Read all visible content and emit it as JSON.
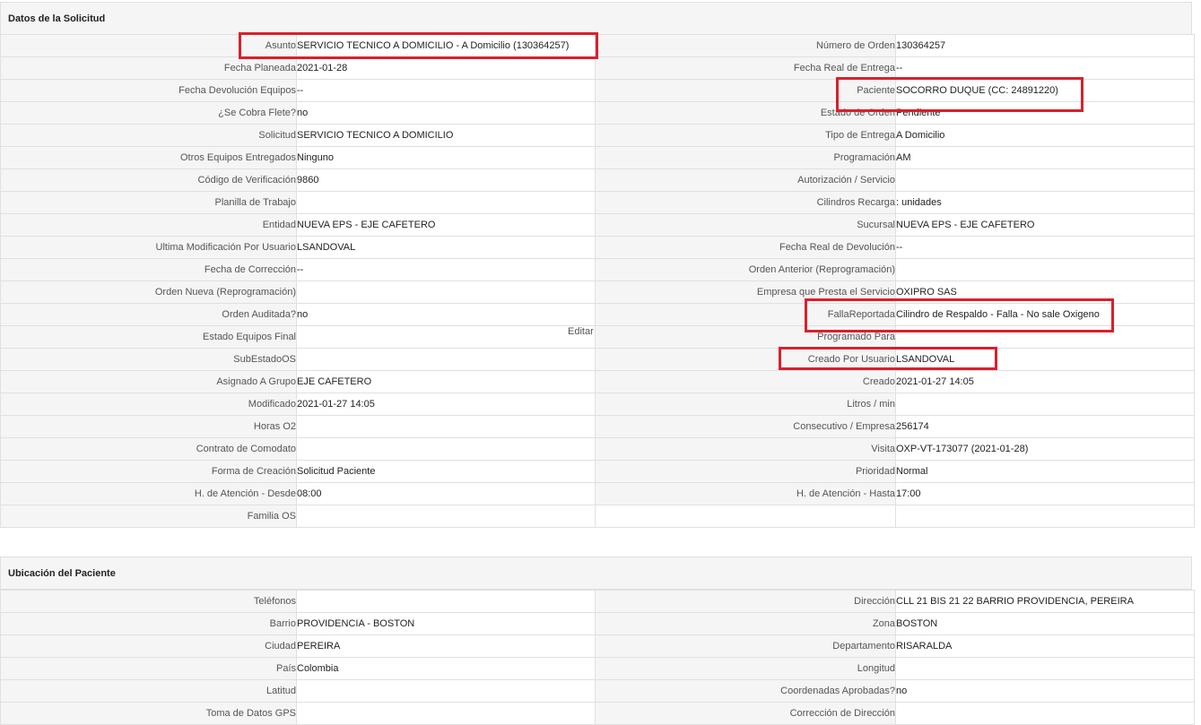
{
  "section1": {
    "title": "Datos de la Solicitud",
    "rows": [
      {
        "l1": "Asunto",
        "v1": "SERVICIO TECNICO A DOMICILIO - A Domicilio (130364257)",
        "l2": "Número de Orden",
        "v2": "130364257"
      },
      {
        "l1": "Fecha Planeada",
        "v1": " 2021-01-28",
        "l2": "Fecha Real de Entrega",
        "v2": "--"
      },
      {
        "l1": "Fecha Devolución Equipos",
        "v1": "--",
        "l2": "Paciente",
        "v2": "SOCORRO DUQUE (CC: 24891220)"
      },
      {
        "l1": "¿Se Cobra Flete?",
        "v1": " no",
        "l2": "Estado de Orden",
        "v2": "Pendiente"
      },
      {
        "l1": "Solicitud",
        "v1": "SERVICIO TECNICO A DOMICILIO",
        "l2": "Tipo de Entrega",
        "v2": "A Domicilio"
      },
      {
        "l1": "Otros Equipos Entregados",
        "v1": "Ninguno",
        "l2": "Programación",
        "v2": "AM"
      },
      {
        "l1": "Código de Verificación",
        "v1": "9860",
        "l2": "Autorización / Servicio",
        "v2": ""
      },
      {
        "l1": "Planilla de Trabajo",
        "v1": "",
        "l2": "Cilindros Recarga",
        "v2": ": unidades"
      },
      {
        "l1": "Entidad",
        "v1": "NUEVA EPS - EJE CAFETERO",
        "l2": "Sucursal",
        "v2": "NUEVA EPS - EJE CAFETERO"
      },
      {
        "l1": "Ultima Modificación Por Usuario",
        "v1": "LSANDOVAL",
        "l2": "Fecha Real de Devolución",
        "v2": "--"
      },
      {
        "l1": "Fecha de Corrección",
        "v1": "--",
        "l2": "Orden Anterior (Reprogramación)",
        "v2": ""
      },
      {
        "l1": "Orden Nueva (Reprogramación)",
        "v1": "",
        "l2": "Empresa que Presta el Servicio",
        "v2": "OXIPRO SAS"
      },
      {
        "l1": "Orden Auditada?",
        "v1": " no",
        "l2": "FallaReportada",
        "v2": "Cilindro de Respaldo - Falla - No sale Oxigeno"
      },
      {
        "l1": "Estado Equipos Final",
        "v1": "",
        "l2": "Programado Para",
        "v2": ""
      },
      {
        "l1": "SubEstadoOS",
        "v1": "",
        "l2": "Creado Por Usuario",
        "v2": "LSANDOVAL"
      },
      {
        "l1": "Asignado A Grupo",
        "v1": "EJE CAFETERO",
        "l2": "Creado",
        "v2": "2021-01-27 14:05"
      },
      {
        "l1": "Modificado",
        "v1": "2021-01-27 14:05",
        "l2": "Litros / min",
        "v2": ""
      },
      {
        "l1": "Horas O2",
        "v1": "",
        "l2": "Consecutivo / Empresa",
        "v2": "256174"
      },
      {
        "l1": "Contrato de Comodato",
        "v1": "",
        "l2": "Visita",
        "v2": "OXP-VT-173077 (2021-01-28)"
      },
      {
        "l1": "Forma de Creación",
        "v1": "Solicitud Paciente",
        "l2": "Prioridad",
        "v2": "Normal"
      },
      {
        "l1": "H. de Atención - Desde",
        "v1": "08:00",
        "l2": "H. de Atención - Hasta",
        "v2": "17:00"
      },
      {
        "l1": "Familia OS",
        "v1": "",
        "l2": null,
        "v2": null
      }
    ],
    "edit_label": "Editar"
  },
  "section2": {
    "title": "Ubicación del Paciente",
    "rows": [
      {
        "l1": "Teléfonos",
        "v1": "",
        "l2": "Dirección",
        "v2": "CLL 21 BIS 21 22 BARRIO PROVIDENCIA, PEREIRA"
      },
      {
        "l1": "Barrio",
        "v1": "PROVIDENCIA - BOSTON",
        "l2": "Zona",
        "v2": "BOSTON"
      },
      {
        "l1": "Ciudad",
        "v1": "PEREIRA",
        "l2": "Departamento",
        "v2": "RISARALDA"
      },
      {
        "l1": "País",
        "v1": "Colombia",
        "l2": "Longitud",
        "v2": ""
      },
      {
        "l1": "Latitud",
        "v1": "",
        "l2": "Coordenadas Aprobadas?",
        "v2": " no"
      },
      {
        "l1": "Toma de Datos GPS",
        "v1": "",
        "l2": "Corrección de Dirección",
        "v2": ""
      }
    ]
  },
  "highlight_color": "#d9202c"
}
